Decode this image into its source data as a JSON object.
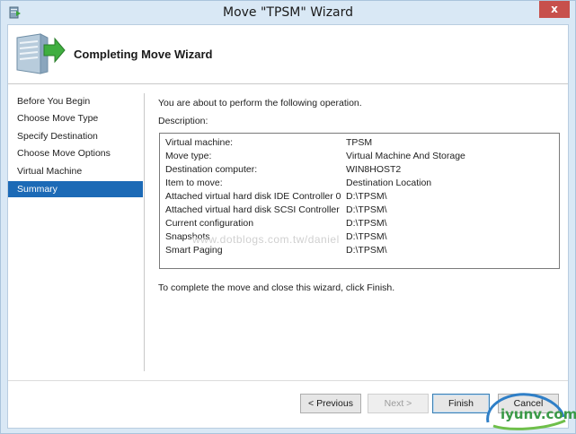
{
  "window": {
    "title": "Move \"TPSM\" Wizard",
    "close_glyph": "x"
  },
  "header": {
    "title": "Completing Move Wizard",
    "icon": "server-with-arrow-icon"
  },
  "nav": {
    "items": [
      {
        "label": "Before You Begin",
        "selected": false
      },
      {
        "label": "Choose Move Type",
        "selected": false
      },
      {
        "label": "Specify Destination",
        "selected": false
      },
      {
        "label": "Choose Move Options",
        "selected": false
      },
      {
        "label": "Virtual Machine",
        "selected": false
      },
      {
        "label": "Summary",
        "selected": true
      }
    ]
  },
  "content": {
    "intro": "You are about to perform the following operation.",
    "description_label": "Description:",
    "rows": [
      {
        "key": "Virtual machine:",
        "value": "TPSM"
      },
      {
        "key": "Move type:",
        "value": "Virtual Machine And Storage"
      },
      {
        "key": "Destination computer:",
        "value": "WIN8HOST2"
      },
      {
        "key": "Item to move:",
        "value": "Destination Location"
      },
      {
        "key": "Attached virtual hard disk  IDE Controller 0",
        "value": "D:\\TPSM\\"
      },
      {
        "key": "Attached virtual hard disk  SCSI Controller",
        "value": "D:\\TPSM\\"
      },
      {
        "key": "Current configuration",
        "value": "D:\\TPSM\\"
      },
      {
        "key": "Snapshots",
        "value": "D:\\TPSM\\"
      },
      {
        "key": "Smart Paging",
        "value": "D:\\TPSM\\"
      }
    ],
    "finish_note": "To complete the move and close this wizard, click Finish."
  },
  "watermark": "www.dotblogs.com.tw/daniel",
  "buttons": {
    "previous": "< Previous",
    "next": "Next >",
    "finish": "Finish",
    "cancel": "Cancel"
  },
  "site_logo": {
    "text": "iyunv.com",
    "icon": "site-logo-icon"
  },
  "colors": {
    "selection": "#1c6ab6",
    "frame": "#d9e8f5",
    "close": "#c7504c",
    "logo": "#3a9a47"
  }
}
